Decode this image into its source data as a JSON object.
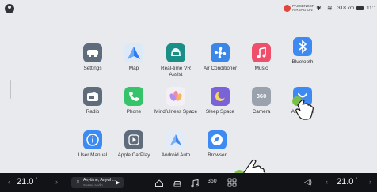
{
  "status_bar": {
    "airbag_line1": "PASSENGER",
    "airbag_line2": "AIRBAG ON",
    "bluetooth_glyph": "✱",
    "wifi_glyph": "≋",
    "range": "318 km",
    "time": "11:1"
  },
  "apps": [
    {
      "label": "Settings"
    },
    {
      "label": "Map"
    },
    {
      "label": "Real-time VR Assist"
    },
    {
      "label": "Air Conditioner"
    },
    {
      "label": "Music"
    },
    {
      "label": "Bluetooth"
    },
    {
      "label": "Radio"
    },
    {
      "label": "Phone"
    },
    {
      "label": "Mindfulness Space"
    },
    {
      "label": "Sleep Space"
    },
    {
      "label": "Camera",
      "glyph": "360"
    },
    {
      "label": "App Store"
    },
    {
      "label": "User Manual"
    },
    {
      "label": "Apple CarPlay"
    },
    {
      "label": "Android Auto"
    },
    {
      "label": "Browser"
    }
  ],
  "dock": {
    "left_chevron": "‹",
    "left_temp": "21.0",
    "left_deg": "°",
    "left_chevron_right": "›",
    "media_title": "Anytime, Anywh...",
    "media_sub": "Seated audio",
    "media_note": "♫",
    "media_play": "▶",
    "cam_glyph": "360",
    "volume_glyph": "◁)",
    "right_chevron_left": "‹",
    "right_temp": "21.0",
    "right_deg": "°",
    "right_chevron": "›"
  },
  "colors": {
    "background": "#e9eaee",
    "dock": "#121317",
    "accent_green": "#7cc241"
  }
}
